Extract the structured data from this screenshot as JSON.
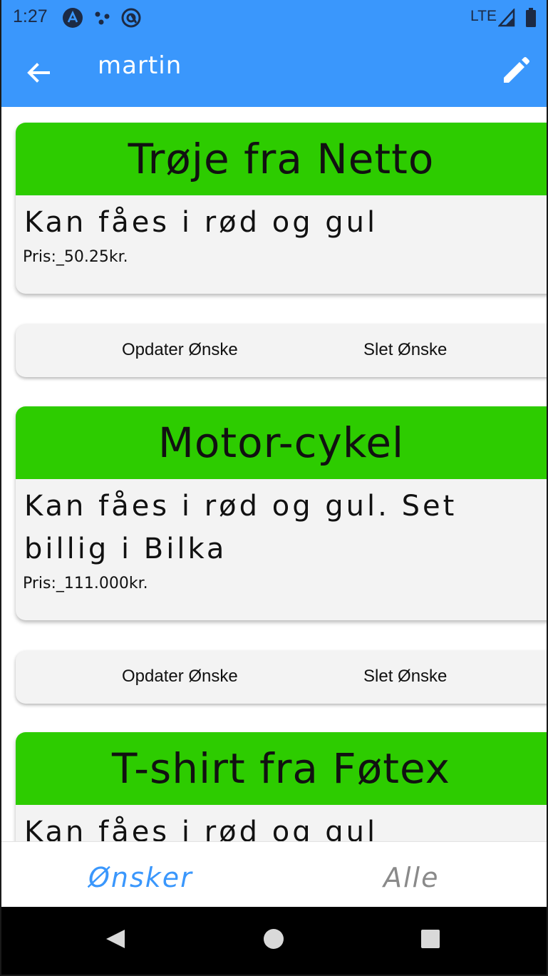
{
  "status": {
    "time": "1:27",
    "network": "LTE"
  },
  "appbar": {
    "title": "martin"
  },
  "wishes": [
    {
      "title": "Trøje fra Netto",
      "description": "Kan fåes i rød og gul",
      "price": "Pris:_50.25kr.",
      "update_label": "Opdater Ønske",
      "delete_label": "Slet Ønske"
    },
    {
      "title": "Motor-cykel",
      "description": "Kan fåes i rød og gul. Set billig i Bilka",
      "price": "Pris:_111.000kr.",
      "update_label": "Opdater Ønske",
      "delete_label": "Slet Ønske"
    },
    {
      "title": "T-shirt fra Føtex",
      "description": "Kan fåes i rød og gul"
    }
  ],
  "bottom_nav": {
    "tabs": [
      {
        "label": "Ønsker",
        "active": true
      },
      {
        "label": "Alle",
        "active": false
      }
    ]
  },
  "colors": {
    "primary": "#3a97fc",
    "card_header": "#2dcc00",
    "active_tab": "#3a97fc",
    "inactive_tab": "#8a8a8a"
  }
}
